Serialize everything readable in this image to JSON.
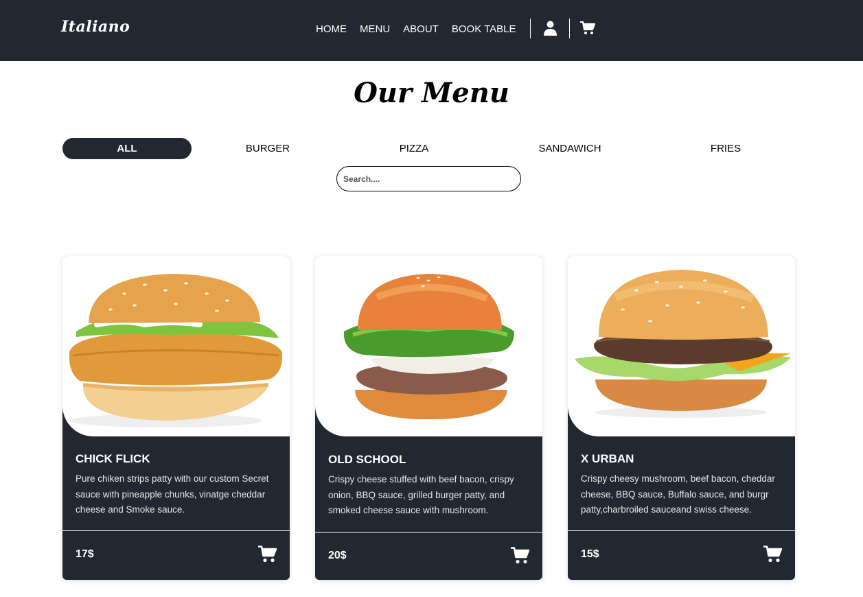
{
  "brand": {
    "logo_text": "Italiano"
  },
  "nav": {
    "items": [
      {
        "label": "HOME"
      },
      {
        "label": "MENU"
      },
      {
        "label": "ABOUT"
      },
      {
        "label": "BOOK TABLE"
      }
    ],
    "icons": [
      "user-icon",
      "cart-icon"
    ]
  },
  "page": {
    "title": "Our Menu"
  },
  "filters": {
    "items": [
      {
        "label": "ALL",
        "active": true
      },
      {
        "label": "BURGER"
      },
      {
        "label": "PIZZA"
      },
      {
        "label": "SANDAWICH"
      },
      {
        "label": "FRIES"
      }
    ]
  },
  "search": {
    "placeholder": "Search....",
    "value": ""
  },
  "cards": [
    {
      "title": "CHICK FLICK",
      "description": "Pure chiken strips patty with our custom Secret sauce with pineapple chunks, vinatge cheddar cheese and Smoke sauce.",
      "price": "17$"
    },
    {
      "title": "OLD SCHOOL",
      "description": "Crispy cheese stuffed with beef bacon, crispy onion, BBQ sauce, grilled burger patty, and smoked cheese sauce with mushroom.",
      "price": "20$"
    },
    {
      "title": "X URBAN",
      "description": "Crispy cheesy mushroom, beef bacon, cheddar cheese, BBQ sauce, Buffalo sauce, and burgr patty,charbroiled sauceand swiss cheese.",
      "price": "15$"
    }
  ],
  "colors": {
    "dark": "#222831",
    "white": "#ffffff",
    "bun": "#e9a85a",
    "lettuce": "#6bbf3a"
  }
}
